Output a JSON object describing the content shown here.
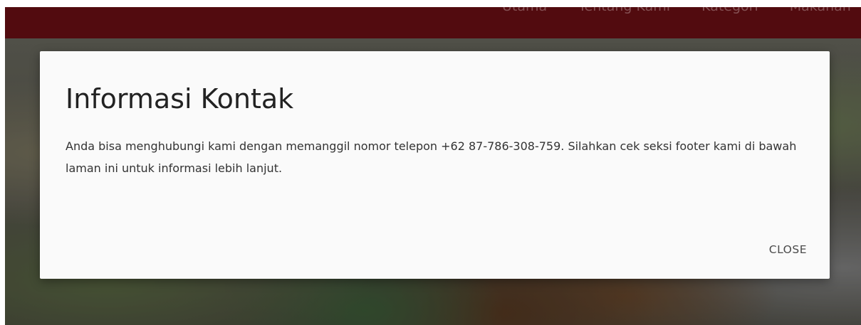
{
  "navbar": {
    "items": [
      {
        "label": "Utama"
      },
      {
        "label": "Tentang Kami"
      },
      {
        "label": "Kategori"
      },
      {
        "label": "Makanan"
      }
    ]
  },
  "modal": {
    "title": "Informasi Kontak",
    "body": "Anda bisa menghubungi kami dengan memanggil nomor telepon +62 87-786-308-759. Silahkan cek seksi footer kami di bawah laman ini untuk informasi lebih lanjut.",
    "close_label": "CLOSE"
  }
}
